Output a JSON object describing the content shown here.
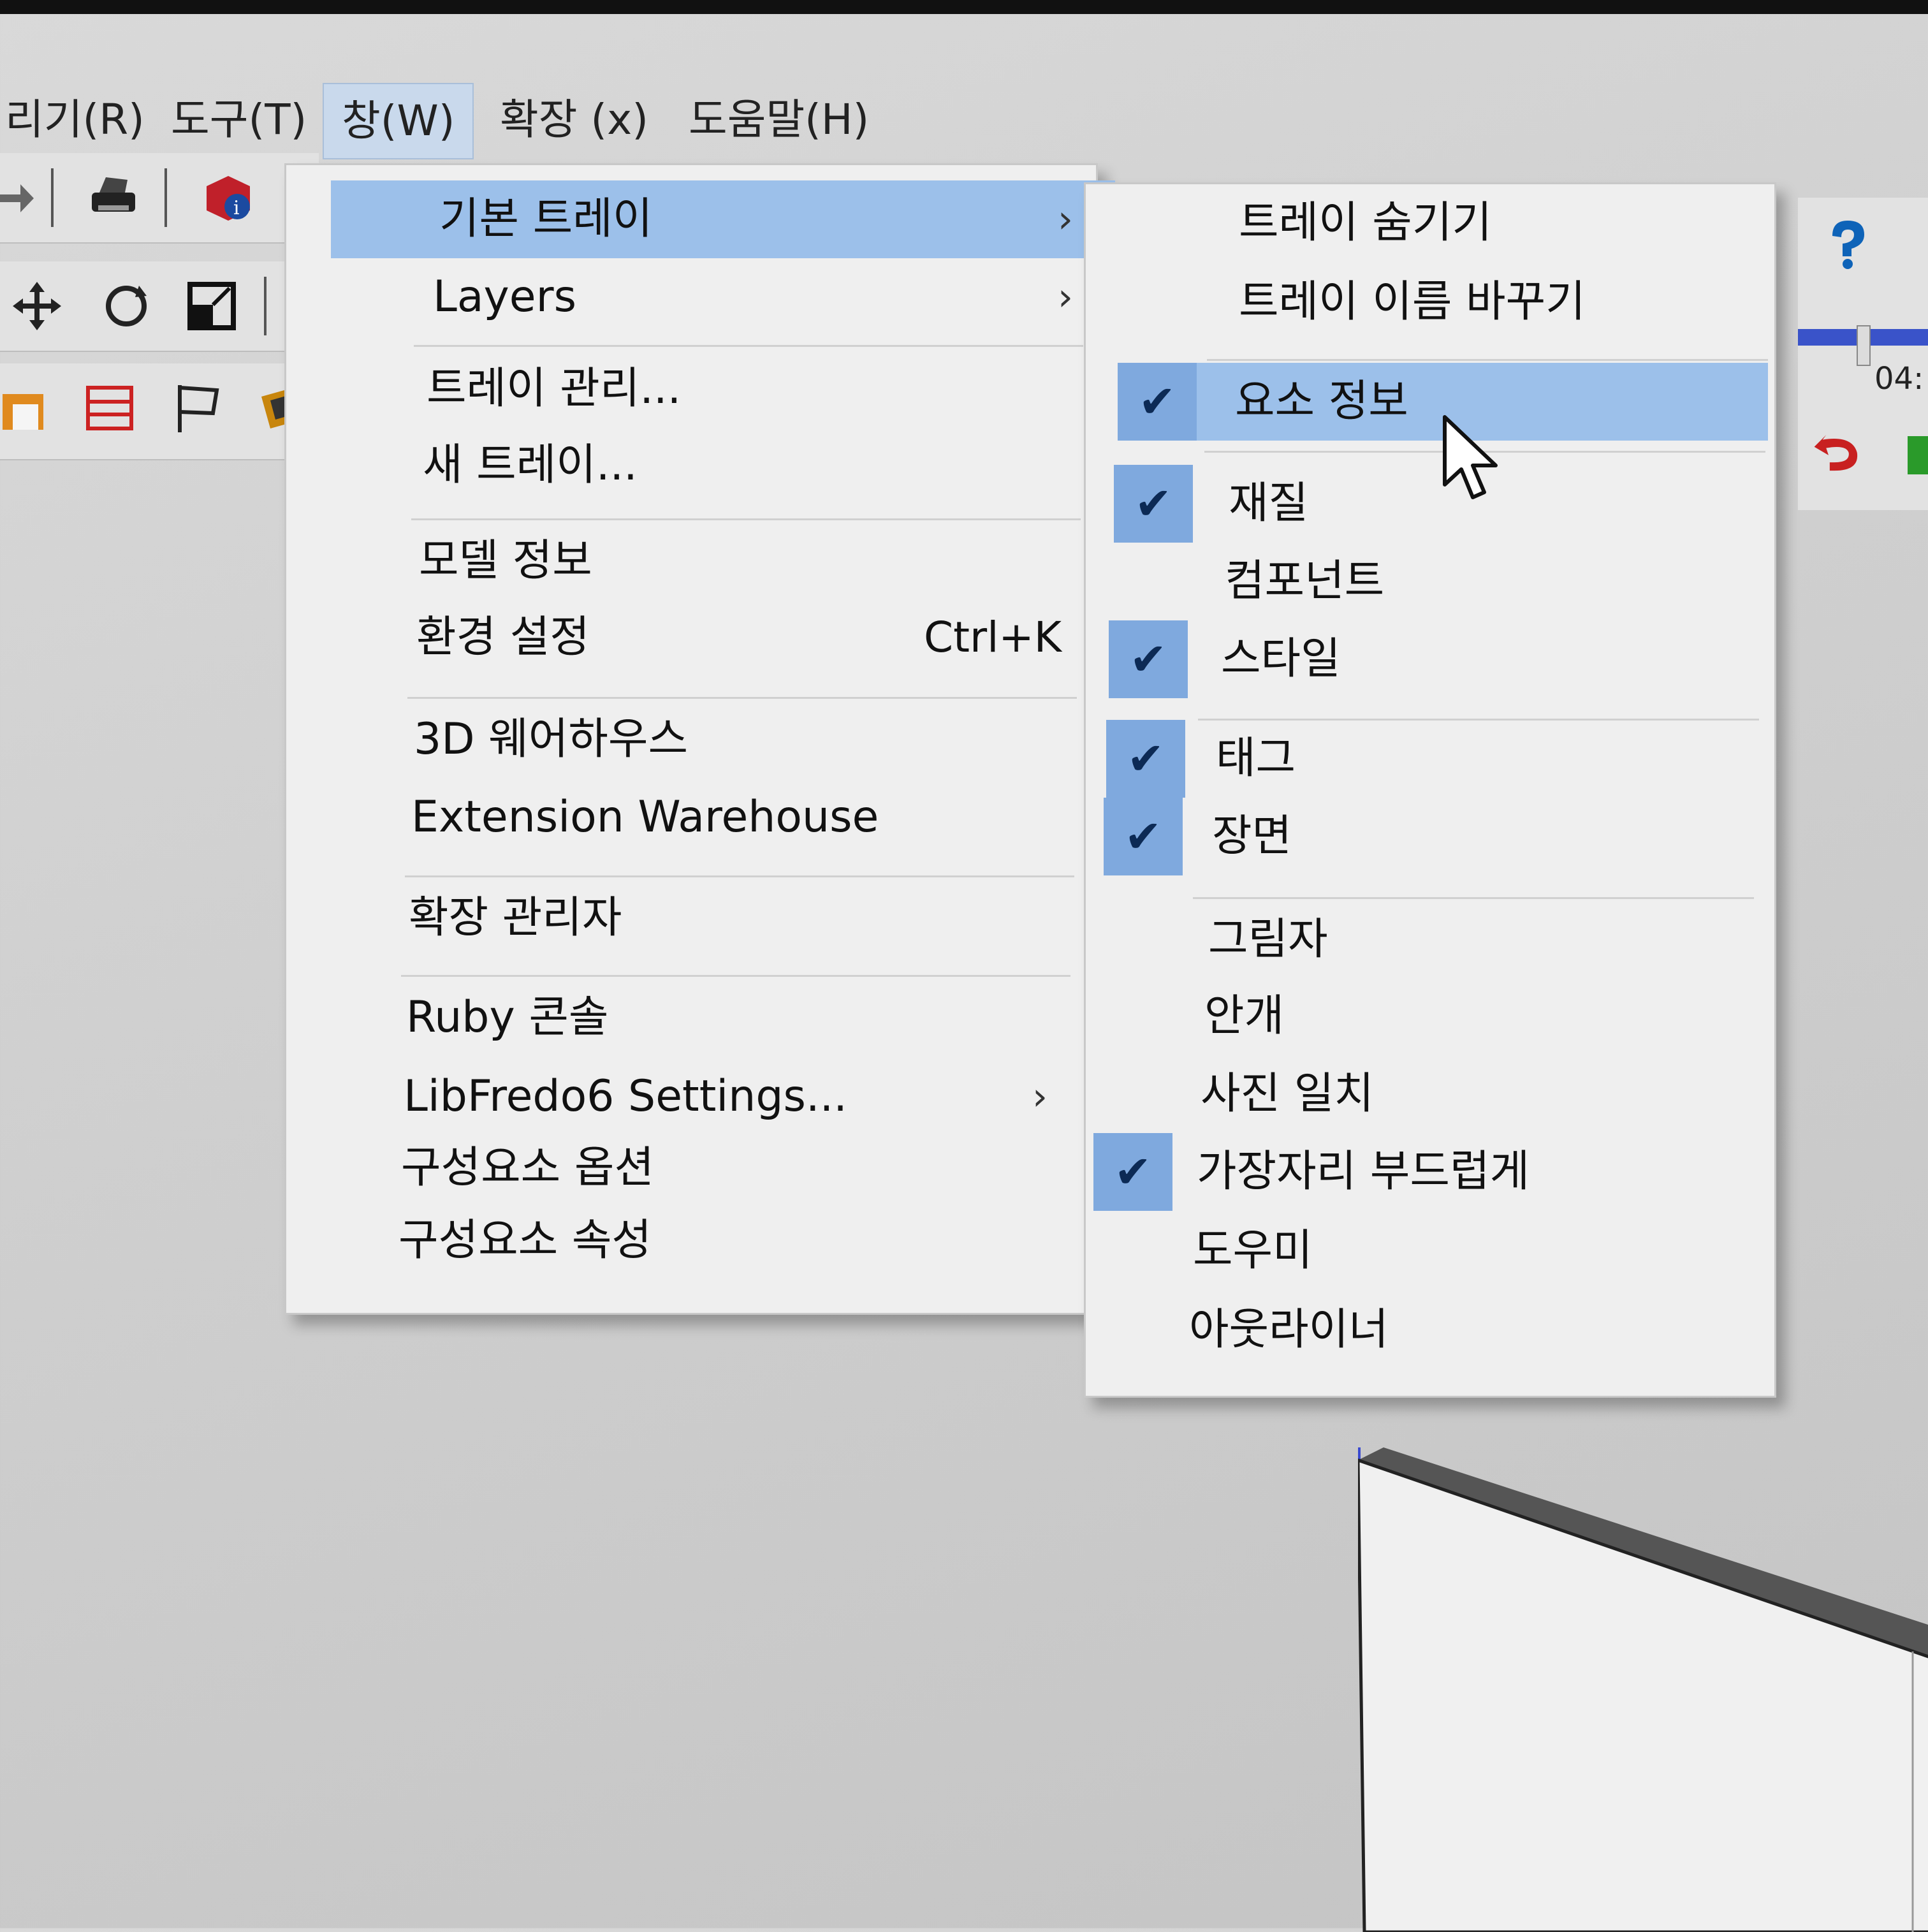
{
  "menubar": {
    "items": [
      {
        "label": "리기(R)"
      },
      {
        "label": "도구(T)"
      },
      {
        "label": "창(W)"
      },
      {
        "label": "확장 (x)"
      },
      {
        "label": "도움말(H)"
      }
    ]
  },
  "window_menu": {
    "items": [
      {
        "label": "기본 트레이"
      },
      {
        "label": "Layers"
      },
      {
        "label": "트레이 관리..."
      },
      {
        "label": "새 트레이..."
      },
      {
        "label": "모델 정보"
      },
      {
        "label": "환경 설정",
        "shortcut": "Ctrl+K"
      },
      {
        "label": "3D 웨어하우스"
      },
      {
        "label": "Extension Warehouse"
      },
      {
        "label": "확장 관리자"
      },
      {
        "label": "Ruby 콘솔"
      },
      {
        "label": "LibFredo6 Settings..."
      },
      {
        "label": "구성요소 옵션"
      },
      {
        "label": "구성요소 속성"
      }
    ]
  },
  "tray_submenu": {
    "items": [
      {
        "label": "트레이 숨기기",
        "checked": false
      },
      {
        "label": "트레이 이름 바꾸기",
        "checked": false
      },
      {
        "label": "요소 정보",
        "checked": true
      },
      {
        "label": "재질",
        "checked": true
      },
      {
        "label": "컴포넌트",
        "checked": false
      },
      {
        "label": "스타일",
        "checked": true
      },
      {
        "label": "태그",
        "checked": true
      },
      {
        "label": "장면",
        "checked": true
      },
      {
        "label": "그림자",
        "checked": false
      },
      {
        "label": "안개",
        "checked": false
      },
      {
        "label": "사진 일치",
        "checked": false
      },
      {
        "label": "가장자리 부드럽게",
        "checked": true
      },
      {
        "label": "도우미",
        "checked": false
      },
      {
        "label": "아웃라이너",
        "checked": false
      }
    ]
  },
  "right_toolbar": {
    "time_readout": "04:"
  },
  "colors": {
    "highlight": "#9cc0ea",
    "check_bg": "#7fa9de",
    "menu_bg": "#efefef"
  }
}
